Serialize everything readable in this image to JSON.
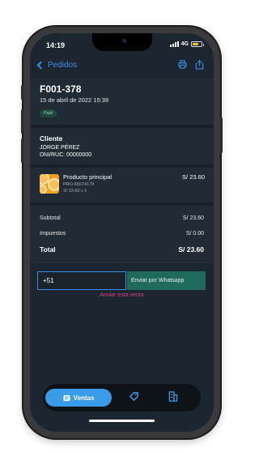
{
  "status": {
    "time": "14:19",
    "network": "4G"
  },
  "nav": {
    "back_label": "Pedidos",
    "print_icon": "printer-icon",
    "share_icon": "share-icon"
  },
  "order": {
    "number": "F001-378",
    "date": "15 de abril de 2022 15:39",
    "status": "Paid"
  },
  "client": {
    "title": "Cliente",
    "name": "JORGE PÉREZ",
    "doc": "DNI/RUC: 00000000"
  },
  "product": {
    "name": "Producto principal",
    "sku": "PRO-65074179",
    "qty_line": "S/ 23.60  x 1",
    "price": "S/ 23.60",
    "icon": "orange-thumbnail"
  },
  "totals": {
    "subtotal_label": "Subtotal",
    "subtotal_value": "S/ 23.60",
    "tax_label": "Impuestos",
    "tax_value": "S/ 0.00",
    "total_label": "Total",
    "total_value": "S/ 23.60"
  },
  "whatsapp": {
    "phone_value": "+51",
    "send_label": "Enviar por Whatsapp"
  },
  "cancel_label": "Anular esta venta",
  "tabs": {
    "active_label": "Ventas",
    "icons": [
      "sales-icon",
      "tag-icon",
      "building-icon"
    ]
  },
  "colors": {
    "accent": "#3a8ee6",
    "danger": "#d6417a",
    "whatsapp": "#1f6a5c",
    "background": "#1c2630"
  }
}
